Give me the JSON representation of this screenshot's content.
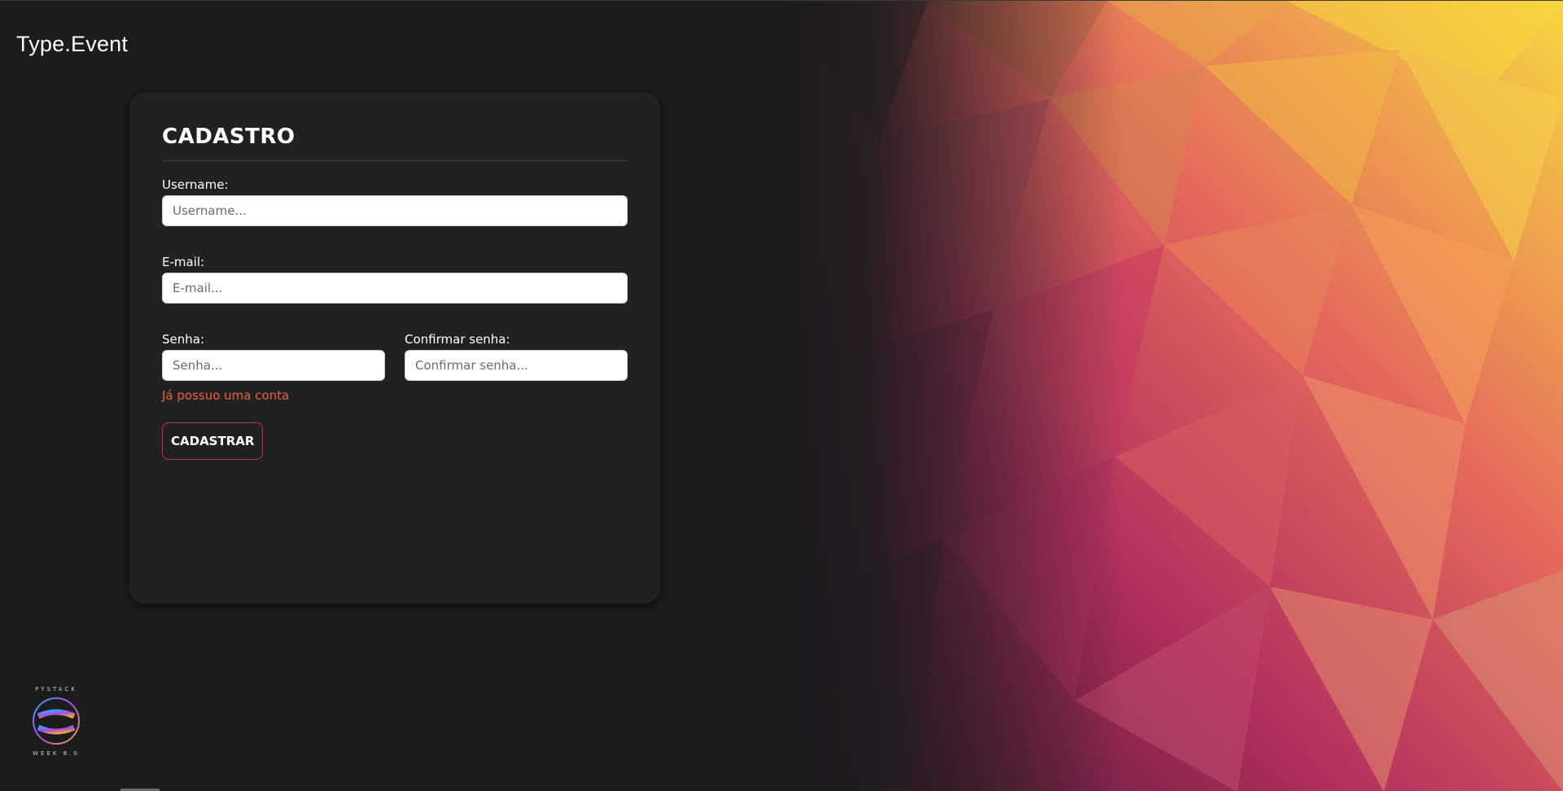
{
  "brand": {
    "title": "Type.Event"
  },
  "form": {
    "title": "CADASTRO",
    "username": {
      "label": "Username:",
      "placeholder": "Username..."
    },
    "email": {
      "label": "E-mail:",
      "placeholder": "E-mail..."
    },
    "password": {
      "label": "Senha:",
      "placeholder": "Senha..."
    },
    "confirm_password": {
      "label": "Confirmar senha:",
      "placeholder": "Confirmar senha..."
    },
    "login_link": "Já possuo uma conta",
    "submit_label": "CADASTRAR"
  },
  "logo": {
    "top_text": "PYSTACK",
    "mark_text": "PYSTACK WEEK",
    "bottom_text": "WEEK 6.0"
  },
  "colors": {
    "background": "#1c1c1d",
    "card": "#212121",
    "link": "#e8623f",
    "button_border": "#c8304f"
  }
}
